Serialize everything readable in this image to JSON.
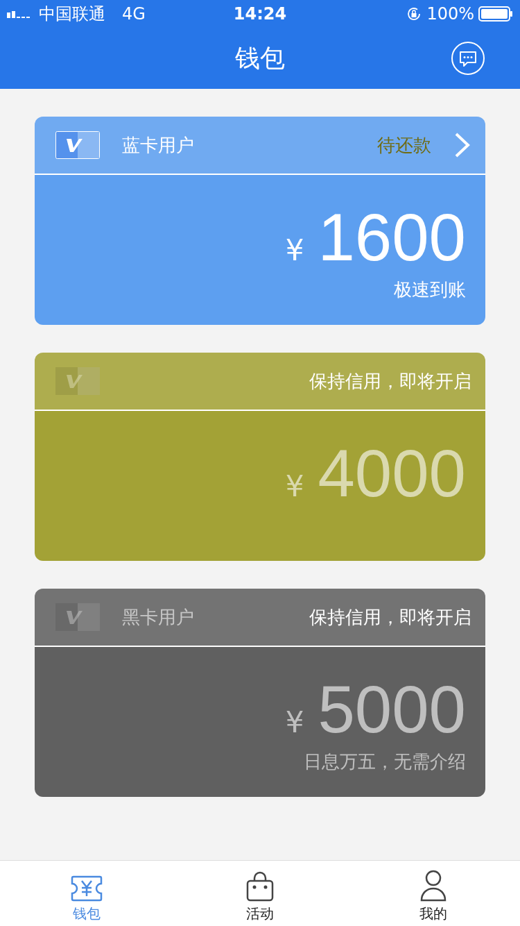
{
  "status_bar": {
    "carrier": "中国联通",
    "network": "4G",
    "time": "14:24",
    "battery": "100%"
  },
  "nav": {
    "title": "钱包"
  },
  "cards": [
    {
      "kind": "active",
      "color": "#5d9ff0",
      "label": "蓝卡用户",
      "status": "待还款",
      "currency": "¥",
      "amount": "1600",
      "note": "极速到账"
    },
    {
      "kind": "locked",
      "color": "#a3a236",
      "notice": "保持信用，即将开启",
      "currency": "¥",
      "amount": "4000"
    },
    {
      "kind": "locked",
      "color": "#606060",
      "label": "黑卡用户",
      "notice": "保持信用，即将开启",
      "currency": "¥",
      "amount": "5000",
      "note": "日息万五，无需介绍"
    }
  ],
  "tabs": [
    {
      "kind": "wallet",
      "label": "钱包",
      "selected": true
    },
    {
      "kind": "bag",
      "label": "活动",
      "selected": false
    },
    {
      "kind": "person",
      "label": "我的",
      "selected": false
    }
  ]
}
